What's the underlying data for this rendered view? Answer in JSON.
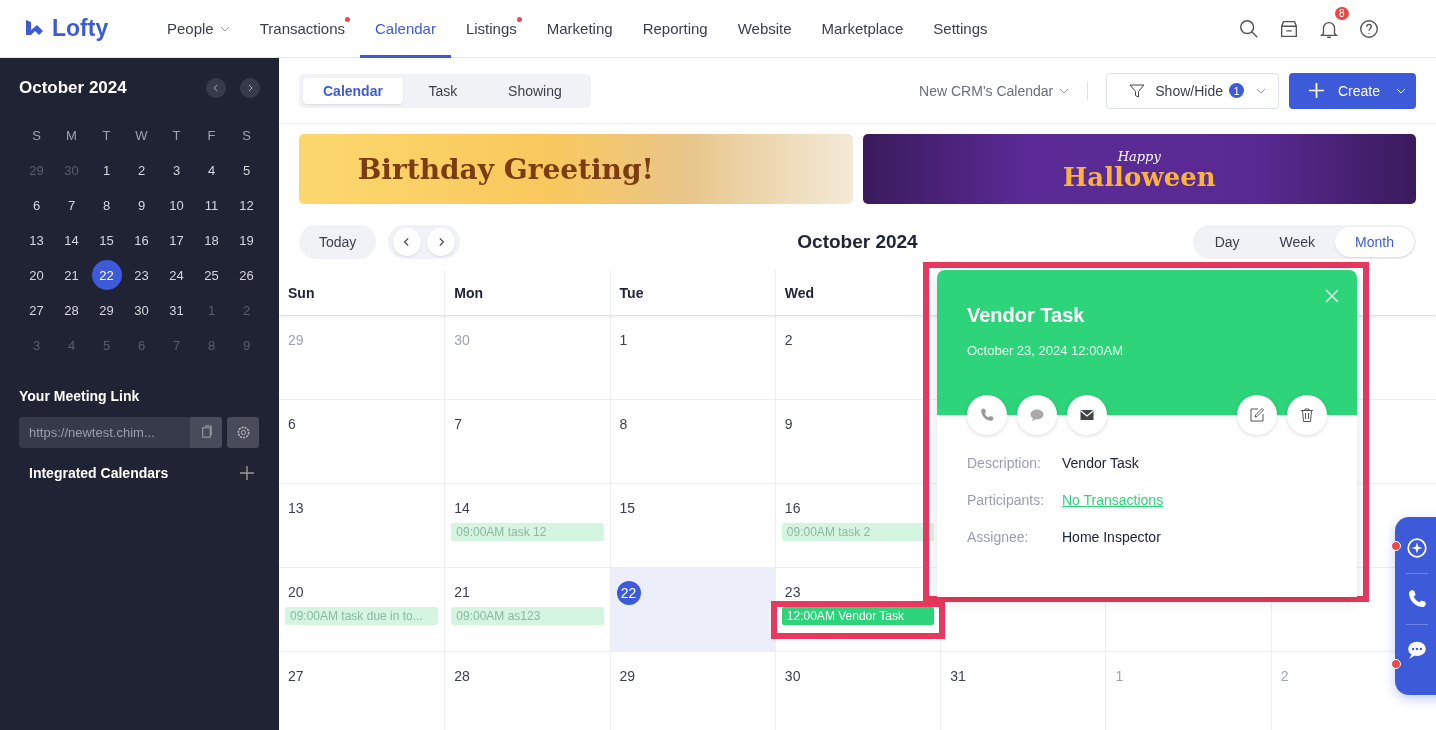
{
  "brand": {
    "name": "Lofty"
  },
  "nav": [
    {
      "label": "People",
      "selected": false,
      "dot": false,
      "dropdown": true
    },
    {
      "label": "Transactions",
      "selected": false,
      "dot": true,
      "dropdown": false
    },
    {
      "label": "Calendar",
      "selected": true,
      "dot": false,
      "dropdown": false
    },
    {
      "label": "Listings",
      "selected": false,
      "dot": true,
      "dropdown": false
    },
    {
      "label": "Marketing",
      "selected": false,
      "dot": false,
      "dropdown": false
    },
    {
      "label": "Reporting",
      "selected": false,
      "dot": false,
      "dropdown": false
    },
    {
      "label": "Website",
      "selected": false,
      "dot": false,
      "dropdown": false
    },
    {
      "label": "Marketplace",
      "selected": false,
      "dot": false,
      "dropdown": false
    },
    {
      "label": "Settings",
      "selected": false,
      "dot": false,
      "dropdown": false
    }
  ],
  "notifications": {
    "count": "8"
  },
  "sidebar": {
    "month_title": "October 2024",
    "weekdays": [
      "S",
      "M",
      "T",
      "W",
      "T",
      "F",
      "S"
    ],
    "weeks": [
      [
        {
          "d": "29",
          "muted": true,
          "selected": false
        },
        {
          "d": "30",
          "muted": true,
          "selected": false
        },
        {
          "d": "1",
          "muted": false,
          "selected": false
        },
        {
          "d": "2",
          "muted": false,
          "selected": false
        },
        {
          "d": "3",
          "muted": false,
          "selected": false
        },
        {
          "d": "4",
          "muted": false,
          "selected": false
        },
        {
          "d": "5",
          "muted": false,
          "selected": false
        }
      ],
      [
        {
          "d": "6",
          "muted": false,
          "selected": false
        },
        {
          "d": "7",
          "muted": false,
          "selected": false
        },
        {
          "d": "8",
          "muted": false,
          "selected": false
        },
        {
          "d": "9",
          "muted": false,
          "selected": false
        },
        {
          "d": "10",
          "muted": false,
          "selected": false
        },
        {
          "d": "11",
          "muted": false,
          "selected": false
        },
        {
          "d": "12",
          "muted": false,
          "selected": false
        }
      ],
      [
        {
          "d": "13",
          "muted": false,
          "selected": false
        },
        {
          "d": "14",
          "muted": false,
          "selected": false
        },
        {
          "d": "15",
          "muted": false,
          "selected": false
        },
        {
          "d": "16",
          "muted": false,
          "selected": false
        },
        {
          "d": "17",
          "muted": false,
          "selected": false
        },
        {
          "d": "18",
          "muted": false,
          "selected": false
        },
        {
          "d": "19",
          "muted": false,
          "selected": false
        }
      ],
      [
        {
          "d": "20",
          "muted": false,
          "selected": false
        },
        {
          "d": "21",
          "muted": false,
          "selected": false
        },
        {
          "d": "22",
          "muted": false,
          "selected": true
        },
        {
          "d": "23",
          "muted": false,
          "selected": false
        },
        {
          "d": "24",
          "muted": false,
          "selected": false
        },
        {
          "d": "25",
          "muted": false,
          "selected": false
        },
        {
          "d": "26",
          "muted": false,
          "selected": false
        }
      ],
      [
        {
          "d": "27",
          "muted": false,
          "selected": false
        },
        {
          "d": "28",
          "muted": false,
          "selected": false
        },
        {
          "d": "29",
          "muted": false,
          "selected": false
        },
        {
          "d": "30",
          "muted": false,
          "selected": false
        },
        {
          "d": "31",
          "muted": false,
          "selected": false
        },
        {
          "d": "1",
          "muted": true,
          "selected": false
        },
        {
          "d": "2",
          "muted": true,
          "selected": false
        }
      ],
      [
        {
          "d": "3",
          "muted": true,
          "selected": false
        },
        {
          "d": "4",
          "muted": true,
          "selected": false
        },
        {
          "d": "5",
          "muted": true,
          "selected": false
        },
        {
          "d": "6",
          "muted": true,
          "selected": false
        },
        {
          "d": "7",
          "muted": true,
          "selected": false
        },
        {
          "d": "8",
          "muted": true,
          "selected": false
        },
        {
          "d": "9",
          "muted": true,
          "selected": false
        }
      ]
    ],
    "meeting_link_title": "Your Meeting Link",
    "meeting_link_value": "https://newtest.chim...",
    "integrated_title": "Integrated Calendars"
  },
  "view_tabs": [
    {
      "label": "Calendar",
      "selected": true
    },
    {
      "label": "Task",
      "selected": false
    },
    {
      "label": "Showing",
      "selected": false
    }
  ],
  "calendar_select": "New CRM's Calendar",
  "show_hide": {
    "label": "Show/Hide",
    "count": "1"
  },
  "create_button": "Create",
  "banners": [
    {
      "kind": "birthday",
      "title": "Birthday Greeting!"
    },
    {
      "kind": "halloween",
      "kicker": "Happy",
      "title": "Halloween"
    }
  ],
  "today_button": "Today",
  "month_title": "October 2024",
  "range_tabs": [
    {
      "label": "Day",
      "selected": false
    },
    {
      "label": "Week",
      "selected": false
    },
    {
      "label": "Month",
      "selected": true
    }
  ],
  "weekday_headers": [
    "Sun",
    "Mon",
    "Tue",
    "Wed"
  ],
  "weeks": [
    [
      {
        "d": "29",
        "muted": true,
        "today": false
      },
      {
        "d": "30",
        "muted": true,
        "today": false
      },
      {
        "d": "1",
        "muted": false,
        "today": false
      },
      {
        "d": "2",
        "muted": false,
        "today": false
      }
    ],
    [
      {
        "d": "6",
        "muted": false,
        "today": false
      },
      {
        "d": "7",
        "muted": false,
        "today": false
      },
      {
        "d": "8",
        "muted": false,
        "today": false
      },
      {
        "d": "9",
        "muted": false,
        "today": false
      }
    ],
    [
      {
        "d": "13",
        "muted": false,
        "today": false
      },
      {
        "d": "14",
        "muted": false,
        "today": false,
        "events": [
          {
            "label": "09:00AM task 12",
            "selected": false
          }
        ]
      },
      {
        "d": "15",
        "muted": false,
        "today": false
      },
      {
        "d": "16",
        "muted": false,
        "today": false,
        "events": [
          {
            "label": "09:00AM task 2",
            "selected": false
          }
        ]
      }
    ],
    [
      {
        "d": "20",
        "muted": false,
        "today": false,
        "events": [
          {
            "label": "09:00AM task due in to...",
            "selected": false
          }
        ]
      },
      {
        "d": "21",
        "muted": false,
        "today": false,
        "events": [
          {
            "label": "09:00AM as123",
            "selected": false
          }
        ]
      },
      {
        "d": "22",
        "muted": false,
        "today": true
      },
      {
        "d": "23",
        "muted": false,
        "today": false,
        "events": [
          {
            "label": "12:00AM Vendor Task",
            "selected": true
          }
        ]
      }
    ],
    [
      {
        "d": "27",
        "muted": false,
        "today": false
      },
      {
        "d": "28",
        "muted": false,
        "today": false
      },
      {
        "d": "29",
        "muted": false,
        "today": false
      },
      {
        "d": "30",
        "muted": false,
        "today": false
      },
      {
        "d": "31",
        "muted": false,
        "today": false
      },
      {
        "d": "1",
        "muted": true,
        "today": false
      },
      {
        "d": "2",
        "muted": true,
        "today": false
      }
    ]
  ],
  "popup": {
    "title": "Vendor Task",
    "datetime": "October 23, 2024 12:00AM",
    "fields": [
      {
        "label": "Description:",
        "value": "Vendor Task",
        "kind": "text"
      },
      {
        "label": "Participants:",
        "value": "No Transactions",
        "kind": "link"
      },
      {
        "label": "Assignee:",
        "value": "Home Inspector",
        "kind": "text"
      }
    ]
  }
}
